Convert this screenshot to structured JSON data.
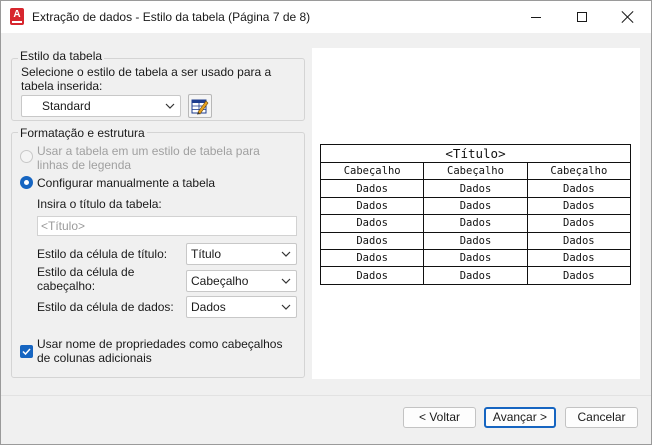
{
  "window": {
    "title": "Extração de dados - Estilo da tabela (Página 7 de 8)",
    "app_icon_letter": "A",
    "controls": [
      "minimize",
      "maximize",
      "close"
    ]
  },
  "table_style_group": {
    "legend": "Estilo da tabela",
    "instruction": "Selecione o estilo de tabela a ser usado para a tabela inserida:",
    "style_select_value": "Standard",
    "style_button_icon": "table-style-edit-icon"
  },
  "format_group": {
    "legend": "Formatação e estrutura",
    "option_use_table_style": "Usar a tabela em um estilo de tabela para linhas de legenda",
    "option_manual": "Configurar manualmente a tabela",
    "title_input_label": "Insira o título da tabela:",
    "title_input_placeholder": "<Título>",
    "title_cell_style_label": "Estilo da célula de título:",
    "title_cell_style_value": "Título",
    "header_cell_style_label": "Estilo da célula de cabeçalho:",
    "header_cell_style_value": "Cabeçalho",
    "data_cell_style_label": "Estilo da célula de dados:",
    "data_cell_style_value": "Dados",
    "use_property_names_label": "Usar nome de propriedades como cabeçalhos de colunas adicionais",
    "use_property_names_checked": true
  },
  "preview": {
    "title": "<Título>",
    "headers": [
      "Cabeçalho",
      "Cabeçalho",
      "Cabeçalho"
    ],
    "rows": [
      [
        "Dados",
        "Dados",
        "Dados"
      ],
      [
        "Dados",
        "Dados",
        "Dados"
      ],
      [
        "Dados",
        "Dados",
        "Dados"
      ],
      [
        "Dados",
        "Dados",
        "Dados"
      ],
      [
        "Dados",
        "Dados",
        "Dados"
      ],
      [
        "Dados",
        "Dados",
        "Dados"
      ]
    ]
  },
  "footer": {
    "back_label": "< Voltar",
    "next_label": "Avançar >",
    "cancel_label": "Cancelar"
  },
  "colors": {
    "accent": "#1665c1",
    "app_icon": "#d7262e",
    "window_bg": "#f0f0f0"
  }
}
